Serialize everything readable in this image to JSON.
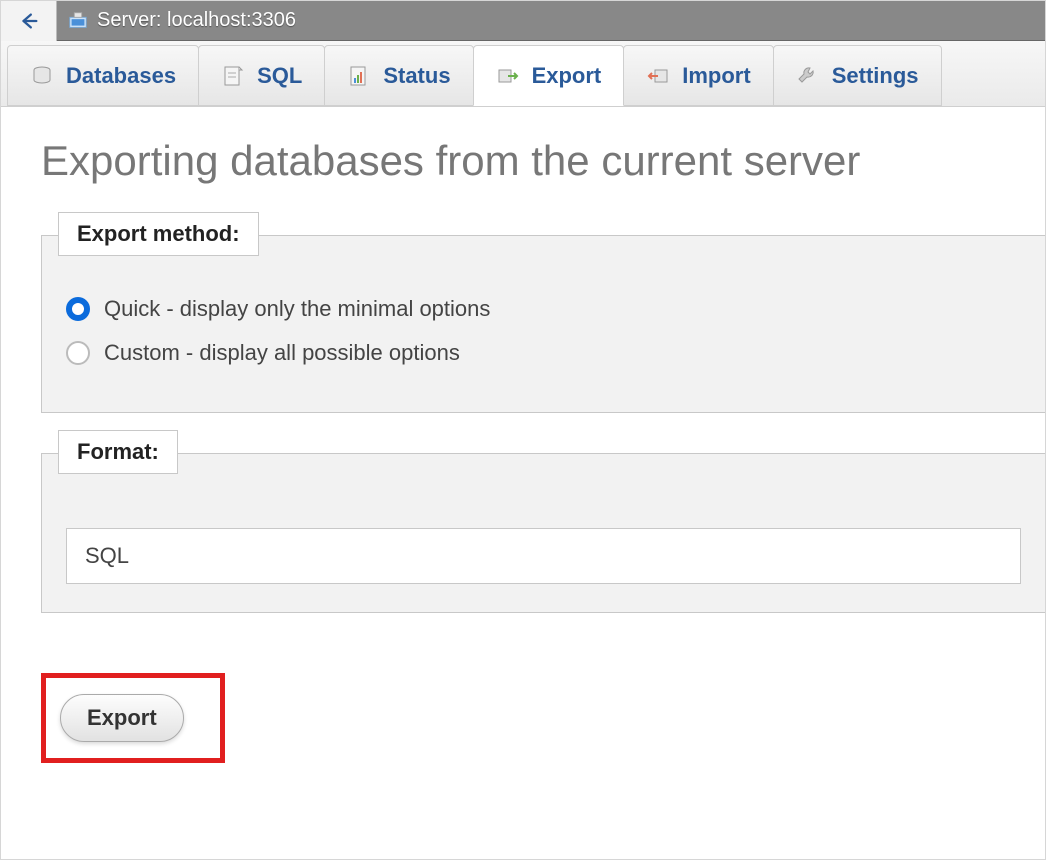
{
  "server_bar": {
    "label": "Server: localhost:3306"
  },
  "tabs": [
    {
      "id": "databases",
      "label": "Databases"
    },
    {
      "id": "sql",
      "label": "SQL"
    },
    {
      "id": "status",
      "label": "Status"
    },
    {
      "id": "export",
      "label": "Export",
      "active": true
    },
    {
      "id": "import",
      "label": "Import"
    },
    {
      "id": "settings",
      "label": "Settings"
    }
  ],
  "page_title": "Exporting databases from the current server",
  "export_method": {
    "legend": "Export method:",
    "options": [
      {
        "id": "quick",
        "label": "Quick - display only the minimal options",
        "checked": true
      },
      {
        "id": "custom",
        "label": "Custom - display all possible options",
        "checked": false
      }
    ]
  },
  "format": {
    "legend": "Format:",
    "selected": "SQL"
  },
  "export_button": "Export"
}
